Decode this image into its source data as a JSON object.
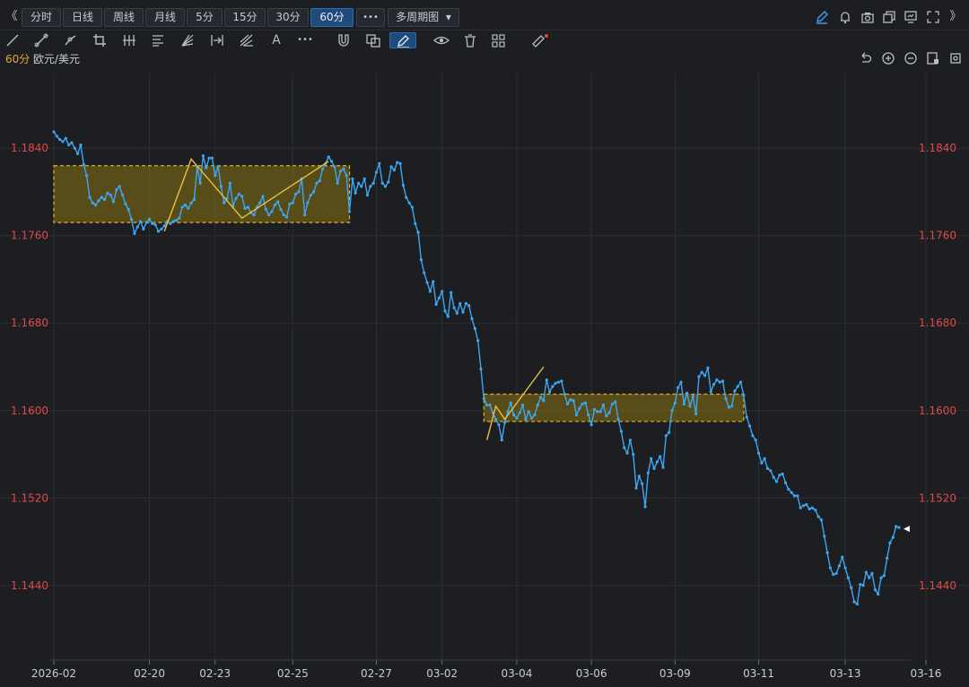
{
  "toolbar": {
    "nav_back_glyph": "《",
    "nav_forward_glyph": "》",
    "periods": [
      "分时",
      "日线",
      "周线",
      "月线",
      "5分",
      "15分",
      "30分",
      "60分"
    ],
    "active_period": "60分",
    "more_label": "•••",
    "multi_period_label": "多周期图",
    "dropdown_glyph": "▾",
    "right_icons": [
      "pencil-icon",
      "bell-icon",
      "camera-icon",
      "copy-window-icon",
      "monitor-icon",
      "fullscreen-icon"
    ]
  },
  "drawing_tools": [
    "line-tool-icon",
    "ray-tool-icon",
    "segment-tool-icon",
    "crop-tool-icon",
    "vertical-lines-icon",
    "horizontal-lines-icon",
    "fan-tool-icon",
    "range-tool-icon",
    "pitchfork-icon",
    "text-tool-icon",
    "more-tools-icon",
    "magnet-icon",
    "clone-icon",
    "pen-icon",
    "eye-icon",
    "trash-icon",
    "layout-icon",
    "ruler-icon"
  ],
  "drawing_tool_glyphs": {
    "text": "A",
    "more": "•••"
  },
  "symbol_bar": {
    "period": "60分",
    "symbol": "欧元/美元",
    "right_icons": [
      "undo-icon",
      "zoom-in-icon",
      "zoom-out-icon",
      "layout-toggle-icon",
      "settings-icon"
    ]
  },
  "colors": {
    "background": "#1c1e22",
    "grid": "#2c2f35",
    "line": "#3ea6f0",
    "price_label": "#e04848",
    "box_fill": "#8a7410",
    "box_border": "#e0b030",
    "trend_line": "#e8c040"
  },
  "chart_data": {
    "type": "line",
    "title": "",
    "xlabel": "",
    "ylabel": "",
    "ylim": [
      1.1375,
      1.1905
    ],
    "y_ticks": [
      "1.1840",
      "1.1760",
      "1.1680",
      "1.1600",
      "1.1520",
      "1.1440"
    ],
    "x_ticks": [
      "2026-02",
      "02-20",
      "02-23",
      "02-25",
      "02-27",
      "03-02",
      "03-04",
      "03-06",
      "03-09",
      "03-11",
      "03-13",
      "03-16"
    ],
    "series": [
      {
        "values": [
          1.1855,
          1.1851,
          1.1848,
          1.1846,
          1.1849,
          1.1843,
          1.1845,
          1.184,
          1.1835,
          1.1843,
          1.1825,
          1.1815,
          1.1795,
          1.179,
          1.1788,
          1.1792,
          1.1795,
          1.1793,
          1.1799,
          1.1797,
          1.1791,
          1.1802,
          1.1805,
          1.1797,
          1.1789,
          1.1784,
          1.1775,
          1.1762,
          1.1768,
          1.1773,
          1.1766,
          1.1772,
          1.1775,
          1.1771,
          1.177,
          1.1764,
          1.1766,
          1.1769,
          1.1773,
          1.1771,
          1.1773,
          1.1774,
          1.1776,
          1.1786,
          1.1788,
          1.1785,
          1.179,
          1.1793,
          1.1823,
          1.1808,
          1.1833,
          1.1822,
          1.1831,
          1.1831,
          1.1815,
          1.1823,
          1.1805,
          1.179,
          1.1794,
          1.1808,
          1.1787,
          1.1794,
          1.1798,
          1.1796,
          1.1785,
          1.1786,
          1.1781,
          1.1779,
          1.1786,
          1.179,
          1.1796,
          1.1784,
          1.1779,
          1.1782,
          1.1788,
          1.1791,
          1.1784,
          1.1779,
          1.1777,
          1.1789,
          1.179,
          1.1798,
          1.18,
          1.1812,
          1.1779,
          1.179,
          1.1797,
          1.18,
          1.1808,
          1.181,
          1.1821,
          1.1826,
          1.1832,
          1.1828,
          1.1823,
          1.1808,
          1.1819,
          1.1821,
          1.1815,
          1.1782,
          1.1812,
          1.1799,
          1.1808,
          1.1805,
          1.1812,
          1.1797,
          1.1805,
          1.1808,
          1.1818,
          1.1826,
          1.1808,
          1.1805,
          1.1809,
          1.1823,
          1.182,
          1.1827,
          1.1826,
          1.1806,
          1.1795,
          1.179,
          1.1786,
          1.1771,
          1.1763,
          1.1738,
          1.1726,
          1.1717,
          1.1709,
          1.1718,
          1.1697,
          1.1703,
          1.1709,
          1.1691,
          1.1686,
          1.1708,
          1.1694,
          1.1689,
          1.1698,
          1.169,
          1.1698,
          1.1696,
          1.1684,
          1.1675,
          1.1664,
          1.1638,
          1.1611,
          1.1605,
          1.1605,
          1.1598,
          1.1592,
          1.1587,
          1.1573,
          1.1589,
          1.1599,
          1.1607,
          1.1596,
          1.1593,
          1.1598,
          1.1605,
          1.1592,
          1.1599,
          1.1593,
          1.1596,
          1.1605,
          1.1612,
          1.1609,
          1.1628,
          1.1617,
          1.1622,
          1.1625,
          1.1626,
          1.1627,
          1.1615,
          1.1606,
          1.161,
          1.1609,
          1.1596,
          1.1602,
          1.1606,
          1.1607,
          1.1596,
          1.1587,
          1.1601,
          1.1599,
          1.1599,
          1.1605,
          1.1595,
          1.1598,
          1.1606,
          1.1608,
          1.1592,
          1.1581,
          1.1566,
          1.1561,
          1.1573,
          1.156,
          1.1529,
          1.154,
          1.1533,
          1.1512,
          1.1543,
          1.1556,
          1.1547,
          1.1553,
          1.1558,
          1.1548,
          1.1577,
          1.158,
          1.16,
          1.1607,
          1.1621,
          1.1626,
          1.1606,
          1.1616,
          1.1604,
          1.1613,
          1.1597,
          1.1631,
          1.1635,
          1.1632,
          1.1639,
          1.1617,
          1.1624,
          1.1628,
          1.1626,
          1.1627,
          1.1611,
          1.1603,
          1.1604,
          1.1618,
          1.1622,
          1.1626,
          1.1614,
          1.1594,
          1.1586,
          1.1577,
          1.1573,
          1.1561,
          1.1552,
          1.1556,
          1.1547,
          1.1545,
          1.1539,
          1.1535,
          1.1541,
          1.1542,
          1.1534,
          1.1528,
          1.1525,
          1.1522,
          1.1522,
          1.1511,
          1.1513,
          1.1514,
          1.151,
          1.1511,
          1.1509,
          1.1503,
          1.15,
          1.1485,
          1.147,
          1.1456,
          1.145,
          1.1451,
          1.1458,
          1.1466,
          1.1456,
          1.1447,
          1.1438,
          1.1425,
          1.1423,
          1.1441,
          1.144,
          1.1452,
          1.1447,
          1.1451,
          1.1436,
          1.1432,
          1.1447,
          1.1449,
          1.1465,
          1.1479,
          1.1484,
          1.1494,
          1.1493
        ]
      }
    ],
    "last_price_marker": "◀",
    "zones": [
      {
        "y_low": 1.1772,
        "y_high": 1.1824,
        "x_start_index": 0,
        "x_end_index": 99
      },
      {
        "y_low": 1.159,
        "y_high": 1.1615,
        "x_start_index": 144,
        "x_end_index": 231
      }
    ],
    "trendlines": [
      [
        [
          37,
          1.1764
        ],
        [
          46,
          1.183
        ],
        [
          63,
          1.1776
        ],
        [
          92,
          1.1828
        ]
      ],
      [
        [
          145,
          1.1573
        ],
        [
          148,
          1.1604
        ],
        [
          151,
          1.1592
        ],
        [
          164,
          1.164
        ]
      ]
    ]
  }
}
